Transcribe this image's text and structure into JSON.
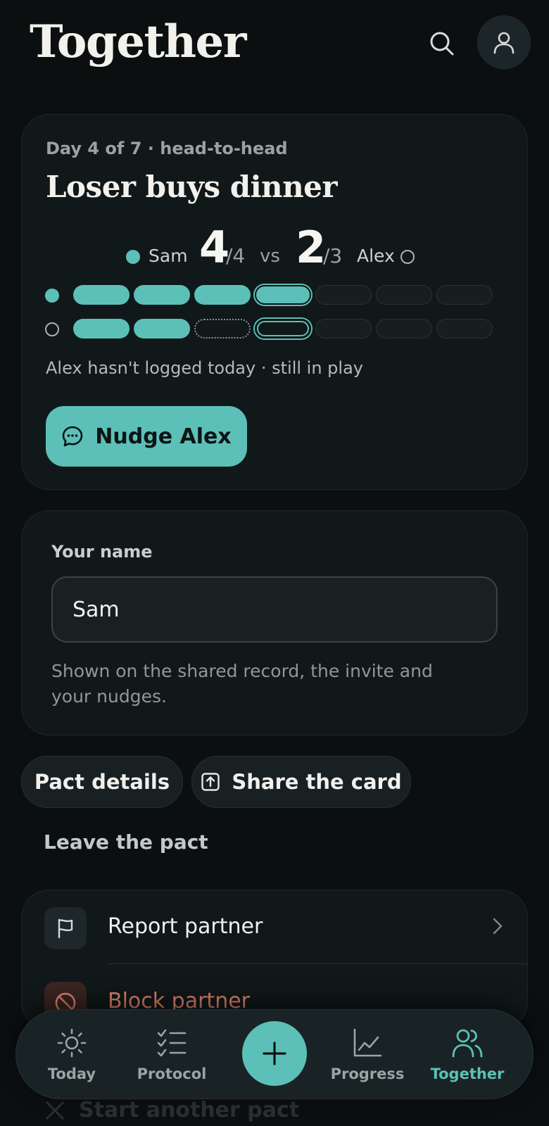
{
  "header": {
    "title": "Together"
  },
  "pact": {
    "meta": "Day 4 of 7 · head-to-head",
    "title": "Loser buys dinner",
    "player1": {
      "name": "Sam",
      "score": "4",
      "possible": "/4"
    },
    "vs": "vs",
    "player2": {
      "name": "Alex",
      "score": "2",
      "possible": "/3"
    },
    "tracks": [
      [
        "done",
        "done",
        "done",
        "today-done",
        "empty",
        "empty",
        "empty"
      ],
      [
        "done",
        "done",
        "missed",
        "today-open",
        "empty",
        "empty",
        "empty"
      ]
    ],
    "status": "Alex hasn't logged today · still in play",
    "nudge_label": "Nudge Alex"
  },
  "name_card": {
    "label": "Your name",
    "value": "Sam",
    "help": "Shown on the shared record, the invite and your nudges."
  },
  "actions": {
    "details_label": "Pact details",
    "share_label": "Share the card",
    "leave_label": "Leave the pact"
  },
  "partner_menu": {
    "items": [
      {
        "label": "Report partner",
        "icon": "flag-icon"
      },
      {
        "label": "Block partner",
        "icon": "block-icon"
      }
    ]
  },
  "below_fold": {
    "label": "Start another pact"
  },
  "tabbar": {
    "tabs": [
      {
        "label": "Today",
        "icon": "sun-icon"
      },
      {
        "label": "Protocol",
        "icon": "checklist-icon"
      },
      {
        "label": "Progress",
        "icon": "chart-icon"
      },
      {
        "label": "Together",
        "icon": "people-icon"
      }
    ],
    "active": "Together",
    "fab_icon": "plus-icon"
  },
  "colors": {
    "accent": "#5cc0b8",
    "background": "#0b0f10",
    "card": "#111819",
    "danger": "#e0826c"
  }
}
